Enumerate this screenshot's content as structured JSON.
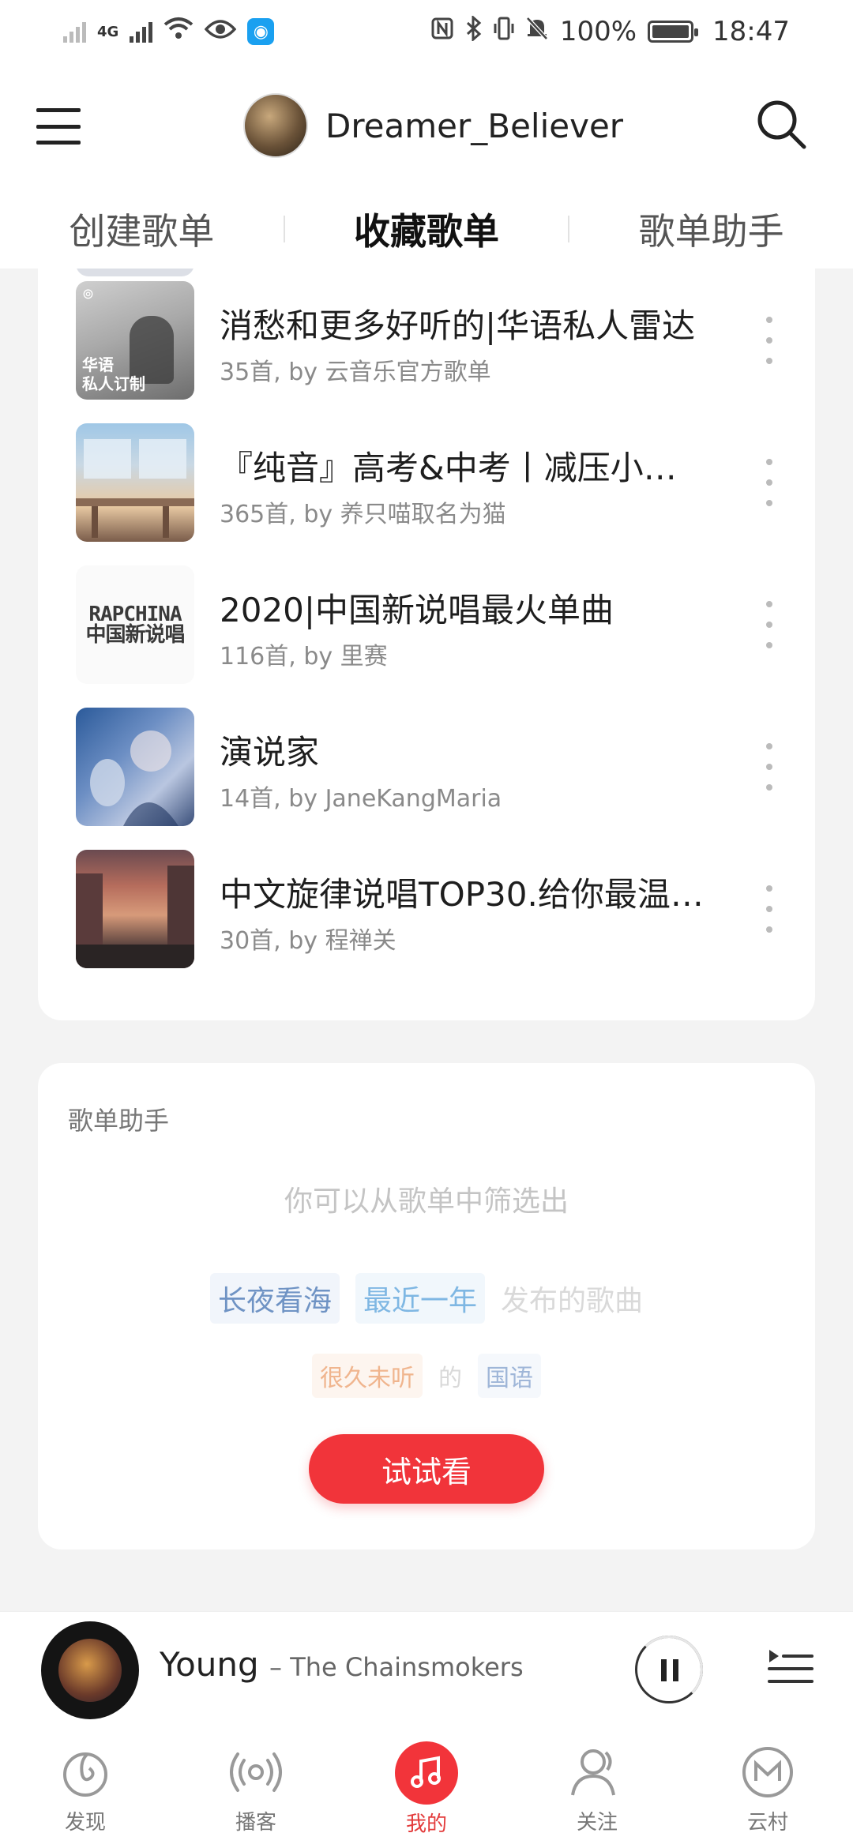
{
  "status_bar": {
    "network": "4G",
    "battery": "100%",
    "time": "18:47"
  },
  "header": {
    "username": "Dreamer_Believer"
  },
  "tabs": [
    {
      "label": "创建歌单",
      "active": false
    },
    {
      "label": "收藏歌单",
      "active": true
    },
    {
      "label": "歌单助手",
      "active": false
    }
  ],
  "playlists": [
    {
      "title": "消愁和更多好听的|华语私人雷达",
      "subtitle": "35首, by 云音乐官方歌单",
      "cover_label": "华语\n私人订制"
    },
    {
      "title": "『纯音』高考&中考丨减压小…",
      "subtitle": "365首, by 养只喵取名为猫"
    },
    {
      "title": "2020|中国新说唱最火单曲",
      "subtitle": "116首, by 里赛",
      "cover_text": "RAPCHINA\n中国新说唱"
    },
    {
      "title": "演说家",
      "subtitle": "14首, by JaneKangMaria"
    },
    {
      "title": "中文旋律说唱TOP30.给你最温…",
      "subtitle": "30首, by 程禅关"
    }
  ],
  "helper": {
    "title": "歌单助手",
    "description": "你可以从歌单中筛选出",
    "line1": {
      "chip1": "长夜看海",
      "chip2": "最近一年",
      "suffix": "发布的歌曲"
    },
    "line2": {
      "chip1": "很久未听",
      "middle": "的",
      "chip2": "国语"
    },
    "button": "试试看"
  },
  "player": {
    "song": "Young",
    "artist": "The Chainsmokers",
    "state": "playing"
  },
  "bottom_nav": [
    {
      "label": "发现",
      "icon": "discover-icon",
      "active": false
    },
    {
      "label": "播客",
      "icon": "podcast-icon",
      "active": false
    },
    {
      "label": "我的",
      "icon": "music-note-icon",
      "active": true
    },
    {
      "label": "关注",
      "icon": "follow-icon",
      "active": false
    },
    {
      "label": "云村",
      "icon": "cloud-village-icon",
      "active": false
    }
  ],
  "colors": {
    "accent": "#f1343a"
  }
}
